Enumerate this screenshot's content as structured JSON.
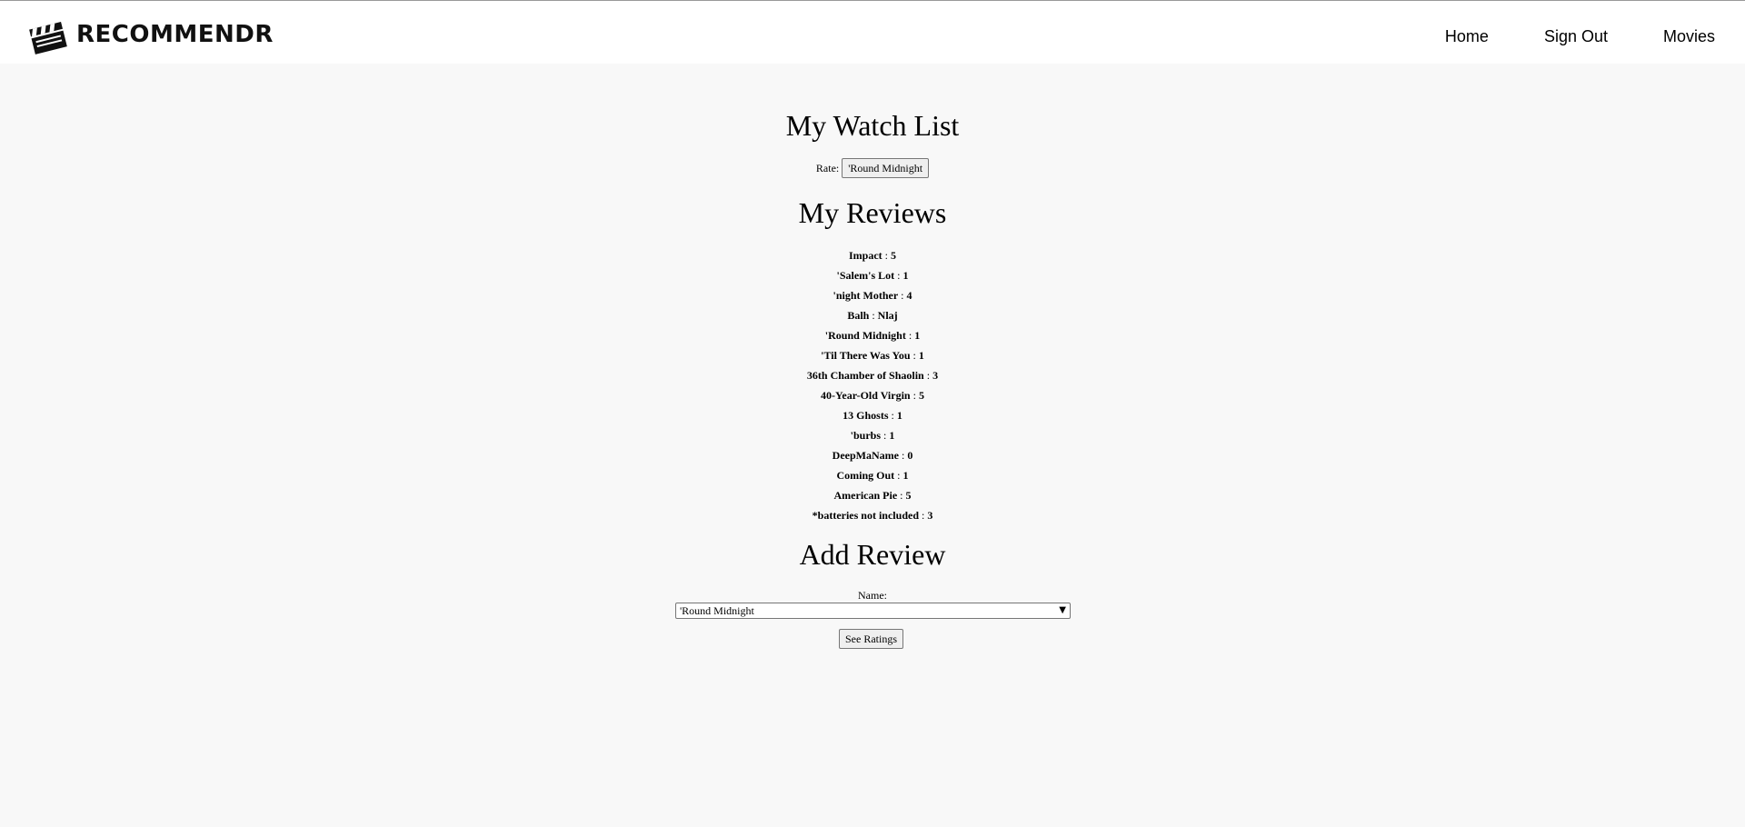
{
  "header": {
    "brand": "RECOMMENDR",
    "nav": [
      {
        "label": "Home"
      },
      {
        "label": "Sign Out"
      },
      {
        "label": "Movies"
      }
    ]
  },
  "watchlist": {
    "title": "My Watch List",
    "rate_label": "Rate:",
    "rate_button": "'Round Midnight"
  },
  "reviews": {
    "title": "My Reviews",
    "items": [
      {
        "name": "Impact",
        "rating": "5"
      },
      {
        "name": "'Salem's Lot",
        "rating": "1"
      },
      {
        "name": "'night Mother",
        "rating": "4"
      },
      {
        "name": "Balh",
        "rating": "Nlaj"
      },
      {
        "name": "'Round Midnight",
        "rating": "1"
      },
      {
        "name": "'Til There Was You",
        "rating": "1"
      },
      {
        "name": "36th Chamber of Shaolin",
        "rating": "3"
      },
      {
        "name": "40-Year-Old Virgin",
        "rating": "5"
      },
      {
        "name": "13 Ghosts",
        "rating": "1"
      },
      {
        "name": "'burbs",
        "rating": "1"
      },
      {
        "name": "DeepMaName",
        "rating": "0"
      },
      {
        "name": "Coming Out",
        "rating": "1"
      },
      {
        "name": "American Pie",
        "rating": "5"
      },
      {
        "name": "*batteries not included",
        "rating": "3"
      }
    ]
  },
  "add_review": {
    "title": "Add Review",
    "name_label": "Name:",
    "selected_movie": "'Round Midnight",
    "submit_label": "See Ratings"
  }
}
